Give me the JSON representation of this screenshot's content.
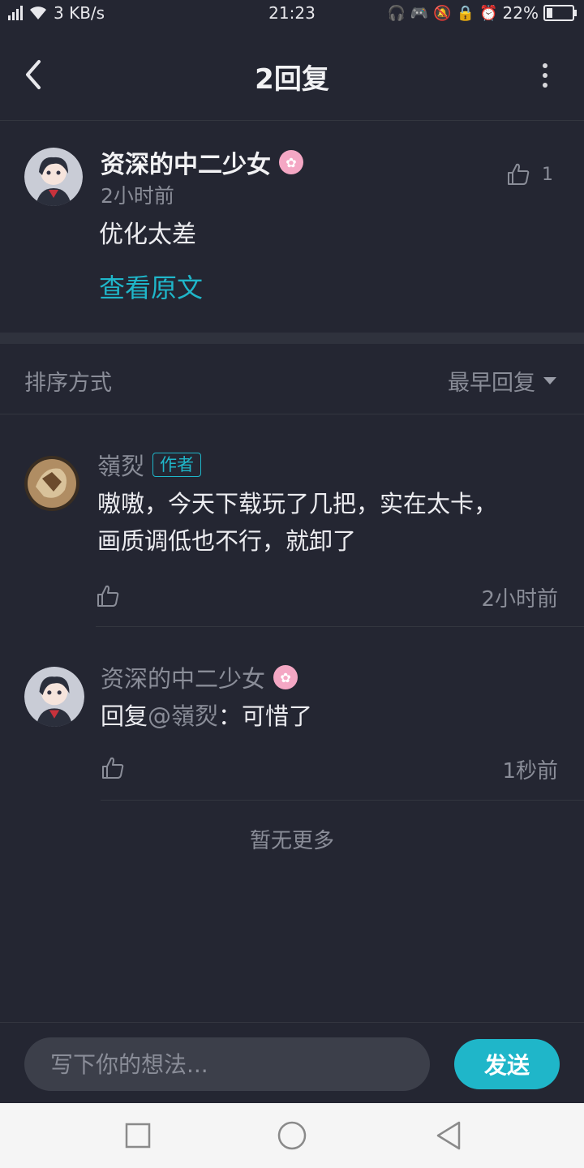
{
  "status_bar": {
    "network_speed": "3 KB/s",
    "time": "21:23",
    "battery": "22%",
    "battery_level": 0.22,
    "icons": [
      "signal-icon",
      "wifi-icon",
      "headphones-icon",
      "gamepad-icon",
      "mute-bell-icon",
      "rotation-lock-icon",
      "alarm-icon",
      "battery-icon"
    ]
  },
  "header": {
    "title": "2回复"
  },
  "original_post": {
    "author": "资深的中二少女",
    "time": "2小时前",
    "text": "优化太差",
    "view_original": "查看原文",
    "likes": "1"
  },
  "sort": {
    "label": "排序方式",
    "value": "最早回复"
  },
  "replies": [
    {
      "author": "嶺烮",
      "tag": "作者",
      "text_line1": "嗷嗷，今天下载玩了几把，实在太卡，",
      "text_line2": "画质调低也不行，就卸了",
      "time": "2小时前"
    },
    {
      "author": "资深的中二少女",
      "text_prefix": "回复",
      "mention": "@嶺烮",
      "text_suffix": "：可惜了",
      "time": "1秒前"
    }
  ],
  "no_more": "暂无更多",
  "composer": {
    "placeholder": "写下你的想法...",
    "send_label": "发送"
  },
  "colors": {
    "background": "#242632",
    "accent": "#1fb6c9",
    "muted_text": "#8a8d98",
    "badge_pink": "#f4a7c4"
  }
}
